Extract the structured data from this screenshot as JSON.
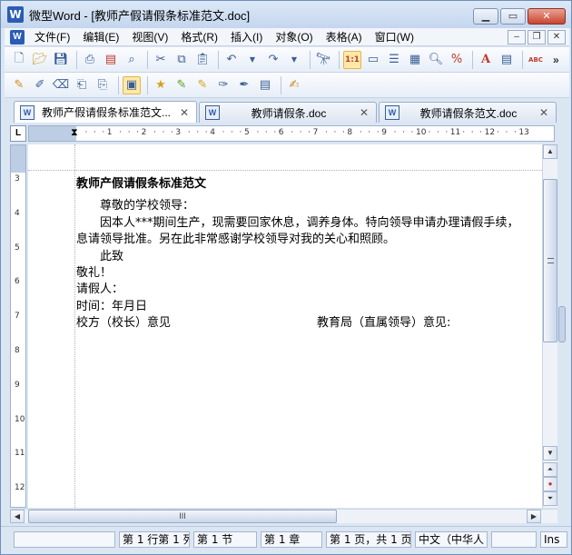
{
  "window": {
    "title": "微型Word - [教师产假请假条标准范文.doc]",
    "app_icon": "W"
  },
  "menubar": {
    "items": [
      "文件(F)",
      "编辑(E)",
      "视图(V)",
      "格式(R)",
      "插入(I)",
      "对象(O)",
      "表格(A)",
      "窗口(W)"
    ]
  },
  "toolbar1": {
    "icons": [
      "new-document-icon",
      "open-folder-icon",
      "save-icon",
      "print-icon",
      "pdf-export-icon",
      "print-preview-icon",
      "cut-icon",
      "copy-icon",
      "paste-icon",
      "undo-icon",
      "redo-icon",
      "find-icon",
      "zoom-actual-size-icon",
      "page-layout-icon",
      "outline-view-icon",
      "web-view-icon",
      "magnifier-icon",
      "zoom-percent-icon",
      "font-color-icon",
      "paragraph-format-icon",
      "spellcheck-icon"
    ],
    "actual_size_label": "1:1",
    "font_label": "A",
    "spell_label": "ABC",
    "more_label": "»"
  },
  "toolbar2": {
    "icons": [
      "edit-mode-icon",
      "insert-field-icon",
      "delete-field-icon",
      "mail-merge-icon",
      "merge-document-icon",
      "macro-icon",
      "highlight-icon",
      "track-changes-icon",
      "accept-change-icon",
      "reject-change-icon",
      "compare-icon",
      "review-pane-icon",
      "signature-icon"
    ]
  },
  "tabs": [
    {
      "label": "教师产假请假条标准范文...",
      "active": true
    },
    {
      "label": "教师请假条.doc",
      "active": false
    },
    {
      "label": "教师请假条范文.doc",
      "active": false
    }
  ],
  "ruler": {
    "corner": "L",
    "h_numbers": [
      "1",
      "2",
      "3",
      "4",
      "5",
      "6",
      "7",
      "8",
      "9",
      "10",
      "11",
      "12",
      "13"
    ],
    "v_numbers": [
      "3",
      "4",
      "5",
      "6",
      "7",
      "8",
      "9",
      "10",
      "11",
      "12"
    ]
  },
  "document": {
    "title": "教师产假请假条标准范文",
    "greeting": "尊敬的学校领导：",
    "body_line1": "因本人***期间生产，现需要回家休息，调养身体。特向领导申请办理请假手续，",
    "body_line2": "息请领导批准。另在此非常感谢学校领导对我的关心和照顾。",
    "closing": "此致",
    "salute": "敬礼！",
    "requester": "请假人：",
    "time": "时间：年月日",
    "opinion_left": "校方（校长）意见",
    "opinion_right": "教育局（直属领导）意见:"
  },
  "scrollbar": {
    "hthumb_grip": "III"
  },
  "statusbar": {
    "position": "第 1 行第 1 列",
    "section": "第 1 节",
    "chapter": "第 1 章",
    "page": "第 1 页，共 1 页",
    "language": "中文（中华人",
    "mode": "Ins"
  }
}
